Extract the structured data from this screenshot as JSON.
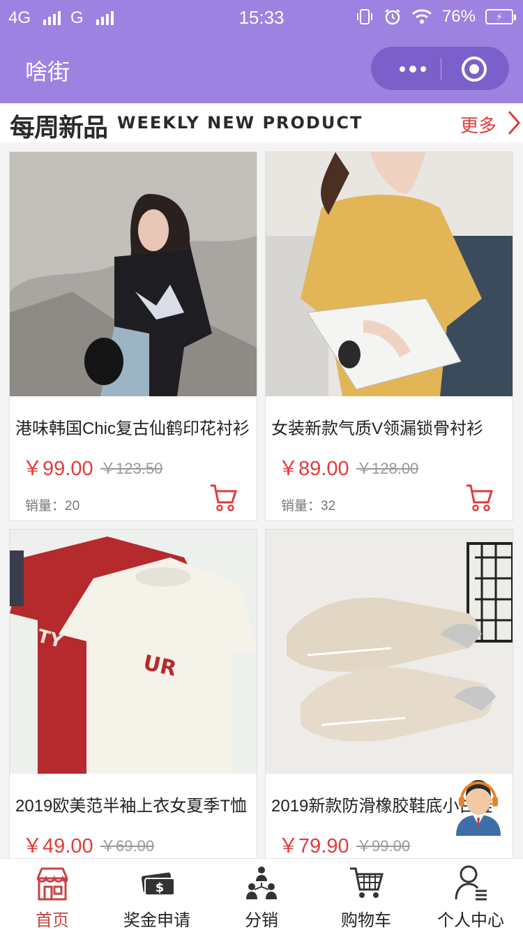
{
  "status_bar": {
    "net1": "4G",
    "net2": "G",
    "time": "15:33",
    "battery": "76%",
    "icons": [
      "vibrate-icon",
      "alarm-icon",
      "wifi-icon",
      "battery-icon"
    ]
  },
  "header": {
    "title": "啥街",
    "menu_icon": "more-dots-icon",
    "close_icon": "target-circle-icon"
  },
  "section": {
    "title_cn": "每周新品",
    "title_en": "WEEKLY NEW PRODUCT",
    "more": "更多"
  },
  "products": [
    {
      "name": "港味韩国Chic复古仙鹤印花衬衫",
      "price": "￥99.00",
      "old_price": "￥123.50",
      "sales": "销量：20"
    },
    {
      "name": "女装新款气质V领漏锁骨衬衫",
      "price": "￥89.00",
      "old_price": "￥128.00",
      "sales": "销量：32"
    },
    {
      "name": "2019欧美范半袖上衣女夏季T恤",
      "price": "￥49.00",
      "old_price": "￥69.00",
      "sales": ""
    },
    {
      "name": "2019新款防滑橡胶鞋底小白鞋",
      "price": "￥79.90",
      "old_price": "￥99.00",
      "sales": ""
    }
  ],
  "tabbar": [
    {
      "label": "首页",
      "icon": "storefront-icon",
      "active": true
    },
    {
      "label": "奖金申请",
      "icon": "money-icon",
      "active": false
    },
    {
      "label": "分销",
      "icon": "team-icon",
      "active": false
    },
    {
      "label": "购物车",
      "icon": "cart-icon",
      "active": false
    },
    {
      "label": "个人中心",
      "icon": "user-icon",
      "active": false
    }
  ],
  "colors": {
    "header_bg": "#9d82e2",
    "price": "#e23b3b",
    "active_tab": "#c74242"
  }
}
